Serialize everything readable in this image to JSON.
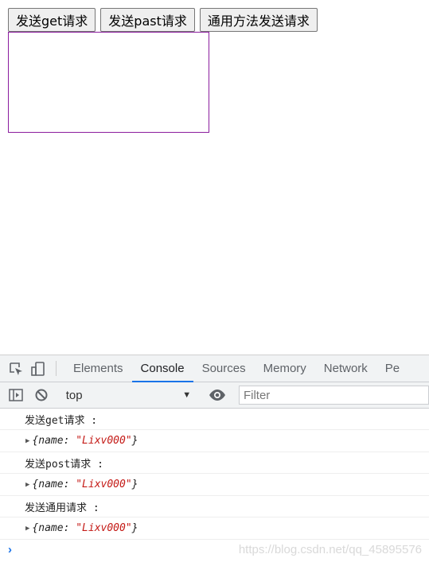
{
  "page": {
    "buttons": [
      {
        "label": "发送get请求"
      },
      {
        "label": "发送past请求"
      },
      {
        "label": "通用方法发送请求"
      }
    ]
  },
  "devtools": {
    "tabs": [
      {
        "label": "Elements"
      },
      {
        "label": "Console",
        "active": true
      },
      {
        "label": "Sources"
      },
      {
        "label": "Memory"
      },
      {
        "label": "Network"
      },
      {
        "label": "Pe"
      }
    ],
    "toolbar": {
      "context": "top",
      "filter_placeholder": "Filter"
    },
    "console": [
      {
        "type": "log",
        "text": "发送get请求 :"
      },
      {
        "type": "object",
        "open": "{",
        "key": "name",
        "colon": ":",
        "value": "\"Lixv000\"",
        "close": "}"
      },
      {
        "type": "log",
        "text": "发送post请求 :"
      },
      {
        "type": "object",
        "open": "{",
        "key": "name",
        "colon": ":",
        "value": "\"Lixv000\"",
        "close": "}"
      },
      {
        "type": "log",
        "text": "发送通用请求 :"
      },
      {
        "type": "object",
        "open": "{",
        "key": "name",
        "colon": ":",
        "value": "\"Lixv000\"",
        "close": "}"
      }
    ],
    "prompt_symbol": "›"
  },
  "watermark": "https://blog.csdn.net/qq_45895576",
  "colors": {
    "box_border": "#8b1d9e",
    "active_tab_indicator": "#1a73e8",
    "string_value": "#c41a16",
    "prompt": "#1a73e8"
  }
}
